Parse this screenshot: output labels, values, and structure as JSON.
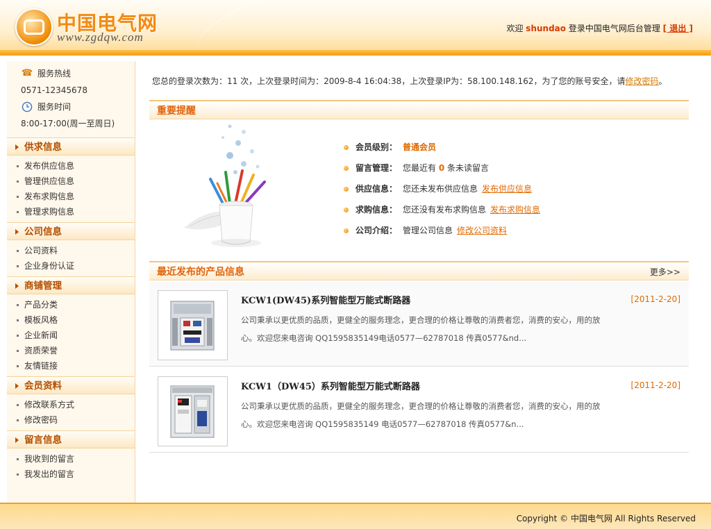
{
  "header": {
    "logo_cn": "中国电气网",
    "logo_url": "www.zgdqw.com",
    "welcome_prefix": "欢迎",
    "username": "shundao",
    "welcome_suffix": "登录中国电气网后台管理",
    "logout": "[ 退出 ]"
  },
  "sidebar": {
    "hotline_label": "服务热线",
    "hotline": "0571-12345678",
    "hours_label": "服务时间",
    "hours": "8:00-17:00(周一至周日)",
    "sections": [
      {
        "title": "供求信息",
        "items": [
          "发布供应信息",
          "管理供应信息",
          "发布求购信息",
          "管理求购信息"
        ]
      },
      {
        "title": "公司信息",
        "items": [
          "公司资料",
          "企业身份认证"
        ]
      },
      {
        "title": "商铺管理",
        "items": [
          "产品分类",
          "模板风格",
          "企业新闻",
          "资质荣誉",
          "友情链接"
        ]
      },
      {
        "title": "会员资料",
        "items": [
          "修改联系方式",
          "修改密码"
        ]
      },
      {
        "title": "留言信息",
        "items": [
          "我收到的留言",
          "我发出的留言"
        ]
      }
    ]
  },
  "login_info": {
    "text": "您总的登录次数为：11 次，上次登录时间为：2009-8-4 16:04:38，上次登录IP为：58.100.148.162，为了您的账号安全，请",
    "link": "修改密码",
    "end": "。"
  },
  "reminder": {
    "title": "重要提醒",
    "member_level_key": "会员级别：",
    "member_level": "普通会员",
    "message_key": "留言管理：",
    "message_pre": "您最近有",
    "message_count": "0",
    "message_post": "条未读留言",
    "supply_key": "供应信息：",
    "supply_text": "您还未发布供应信息",
    "supply_link": "发布供应信息",
    "buy_key": "求购信息：",
    "buy_text": "您还没有发布求购信息",
    "buy_link": "发布求购信息",
    "company_key": "公司介绍：",
    "company_text": "管理公司信息",
    "company_link": "修改公司资料"
  },
  "products": {
    "title": "最近发布的产品信息",
    "more": "更多>>",
    "items": [
      {
        "name": "KCW1(DW45)系列智能型万能式断路器",
        "date": "[2011-2-20]",
        "desc": "公司秉承以更优质的品质，更健全的服务理念，更合理的价格让尊敬的消费者您，消费的安心，用的放心。欢迎您来电咨询 QQ1595835149电话0577—62787018 传真0577&nd..."
      },
      {
        "name": "KCW1（DW45）系列智能型万能式断路器",
        "date": "[2011-2-20]",
        "desc": "公司秉承以更优质的品质，更健全的服务理念，更合理的价格让尊敬的消费者您，消费的安心，用的放心。欢迎您来电咨询 QQ1595835149 电话0577—62787018 传真0577&n..."
      }
    ]
  },
  "footer": {
    "copyright": "Copyright © 中国电气网 All Rights Reserved"
  },
  "colors": {
    "accent": "#e06a00",
    "header_band": "#f39a14",
    "sidebar_bg": "#fff8ec"
  }
}
